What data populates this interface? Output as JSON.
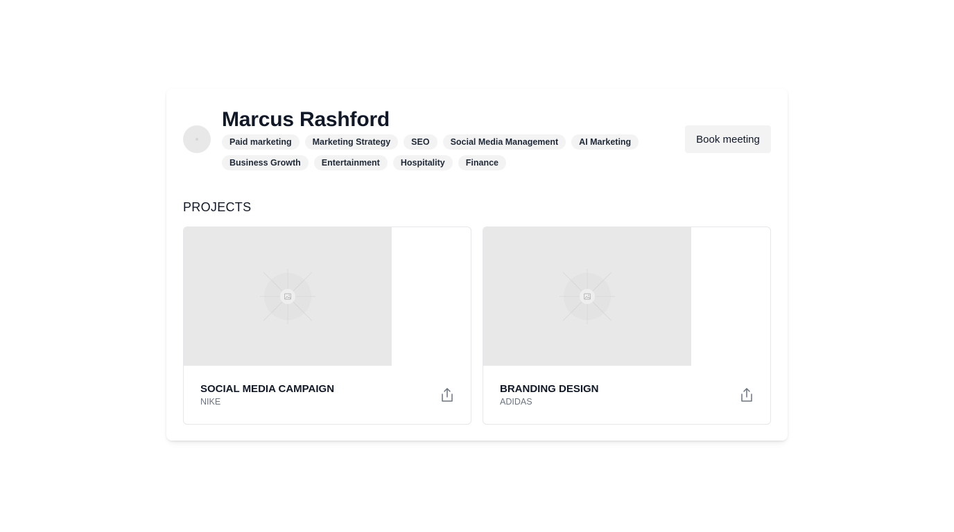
{
  "profile": {
    "name": "Marcus Rashford",
    "tags": [
      "Paid marketing",
      "Marketing Strategy",
      "SEO",
      "Social Media Management",
      "AI Marketing",
      "Business Growth",
      "Entertainment",
      "Hospitality",
      "Finance"
    ],
    "book_button_label": "Book meeting"
  },
  "projects": {
    "heading": "PROJECTS",
    "items": [
      {
        "title": "SOCIAL MEDIA CAMPAIGN",
        "client": "NIKE",
        "thumbnail_icon": "image-placeholder-icon",
        "action_icon": "share-icon"
      },
      {
        "title": "BRANDING DESIGN",
        "client": "ADIDAS",
        "thumbnail_icon": "image-placeholder-icon",
        "action_icon": "share-icon"
      }
    ]
  },
  "colors": {
    "text_primary": "#111827",
    "text_secondary": "#6b7280",
    "tag_background": "#f3f3f3",
    "placeholder_background": "#e8e8e8",
    "border": "#e5e7eb"
  }
}
